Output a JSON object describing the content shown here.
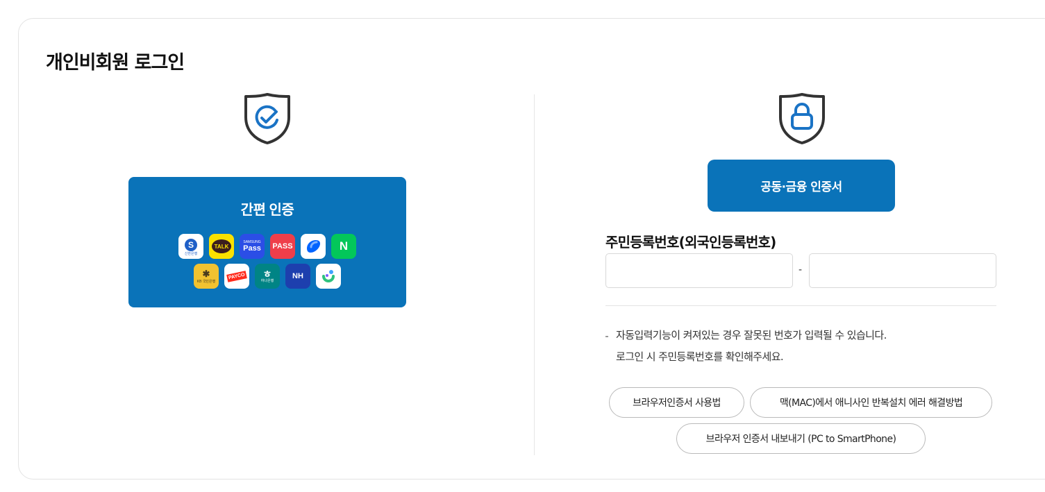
{
  "page": {
    "title": "개인비회원 로그인"
  },
  "easy_auth": {
    "label": "간편 인증",
    "apps": [
      {
        "name": "shinhan-bank-icon",
        "text": "신한은행",
        "color": "#1f5fc7"
      },
      {
        "name": "kakaotalk-icon",
        "text": "TALK",
        "color": "#fae100"
      },
      {
        "name": "samsung-pass-icon",
        "text": "Pass",
        "sub": "SAMSUNG",
        "color": "#2b4ee6"
      },
      {
        "name": "pass-icon",
        "text": "PASS",
        "color": "#ef3e4a"
      },
      {
        "name": "toss-icon",
        "text": "",
        "color": "#ffffff"
      },
      {
        "name": "naver-icon",
        "text": "N",
        "color": "#03c75a"
      },
      {
        "name": "kb-bank-icon",
        "text": "KB 국민은행",
        "color": "#f2c230"
      },
      {
        "name": "payco-icon",
        "text": "PAYCO",
        "color": "#ffffff"
      },
      {
        "name": "hana-bank-icon",
        "text": "하나은행",
        "color": "#008485"
      },
      {
        "name": "nh-bank-icon",
        "text": "NH",
        "color": "#1d3fae"
      },
      {
        "name": "banksalad-icon",
        "text": "",
        "color": "#ffffff"
      }
    ]
  },
  "cert": {
    "button_label": "공동·금융 인증서",
    "ssn_label": "주민등록번호(외국인등록번호)",
    "ssn_front_placeholder": "",
    "ssn_back_placeholder": "",
    "dash": "-",
    "notice_line1": "자동입력기능이 켜져있는 경우 잘못된 번호가 입력될 수 있습니다.",
    "notice_line2": "로그인 시 주민등록번호를 확인해주세요.",
    "links": [
      "브라우저인증서 사용법",
      "맥(MAC)에서 애니사인 반복설치 에러 해결방법",
      "브라우저 인증서 내보내기 (PC to SmartPhone)"
    ]
  },
  "colors": {
    "primary": "#0a73b9",
    "icon_accent": "#1a73c5"
  }
}
